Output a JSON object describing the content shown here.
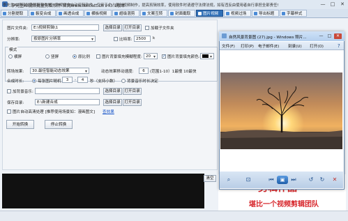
{
  "app": {
    "title": "李先生AI视频批量剪辑软件    官网www.tencett.cn    v43.1版本",
    "minimize": "—",
    "maximize": "□",
    "close": "✕"
  },
  "tabs": [
    {
      "label": "分割提取",
      "active": false
    },
    {
      "label": "裂变合成",
      "active": false
    },
    {
      "label": "画透合成",
      "active": false
    },
    {
      "label": "横板视频",
      "active": false
    },
    {
      "label": "超级混剪",
      "active": false
    },
    {
      "label": "文案互转",
      "active": false
    },
    {
      "label": "封面截取",
      "active": false
    },
    {
      "label": "图片视频",
      "active": true
    },
    {
      "label": "视频过场",
      "active": false
    },
    {
      "label": "导出标题",
      "active": false
    },
    {
      "label": "字幕样式",
      "active": false
    }
  ],
  "form": {
    "image_folder_label": "图片文件夹:",
    "image_folder_value": "E:\\视频剪辑\\1",
    "select_dir": "选择目录",
    "open_dir": "打开目录",
    "add_subfolders": "加载子文件夹",
    "resolution_label": "分辨率:",
    "resolution_value": "按原图片分辨率",
    "bitrate_label": "比特率:",
    "bitrate_value": "2500",
    "bitrate_unit": "k",
    "group_title": "模式",
    "mode_horizontal": "横屏",
    "mode_vertical": "竖屏",
    "mode_original": "原比例",
    "fill_bg_label": "图片背景填充模糊程度:",
    "fill_bg_value": "20",
    "fill_color_label": "图片背景填充颜色:",
    "fill_color_value": "#000000",
    "transition_label": "转场效果:",
    "transition_value": "30.最佳智能动态效果",
    "anim_speed_label": "动态效果移动速度:",
    "anim_speed_value": "6",
    "anim_speed_hint": "(范围1-10）1最慢 10最快",
    "duration_label": "合成时长:",
    "duration_random_label": "每张图片随机",
    "duration_min": "3",
    "duration_max": "4",
    "duration_hint": "秒（支持小数）",
    "music_duration_label": "背景音乐时长决定",
    "bgm_label": "加背景音乐:",
    "bgm_value": "",
    "save_dir_label": "保存目录:",
    "save_dir_value": "E:\\新建合成",
    "auto_cover_label": "图片自动高清处理 [推荐使用场景如：漫画图文]",
    "demo_link": "查效果",
    "start_button": "开始转换",
    "stop_button": "停止转换",
    "clear_button": "清空"
  },
  "status_bar": {
    "text": "李先生AI视频批量剪辑软件是一款视频全自动剪辑软件，仅用于个人原创视频制作，提高剪辑效率，使用软件时请遵守法律法规，如有违反由使用者自行承担全部责任!"
  },
  "background_ad": {
    "line1": "剪辑作品",
    "line2": "堪比一个视频剪辑团队",
    "color": "#d7262b"
  },
  "viewer": {
    "title": "自然风景背景图 (27).jpg - Windows 照片...",
    "menu": [
      "文件(F)",
      "打印(P)",
      "电子邮件(E)",
      "刻录(U)",
      "打开(O)"
    ],
    "toolbar_icons": [
      "zoom-icon",
      "fit-icon",
      "prev-icon",
      "play-icon",
      "next-icon",
      "rotate-left-icon",
      "rotate-right-icon",
      "delete-icon"
    ]
  }
}
